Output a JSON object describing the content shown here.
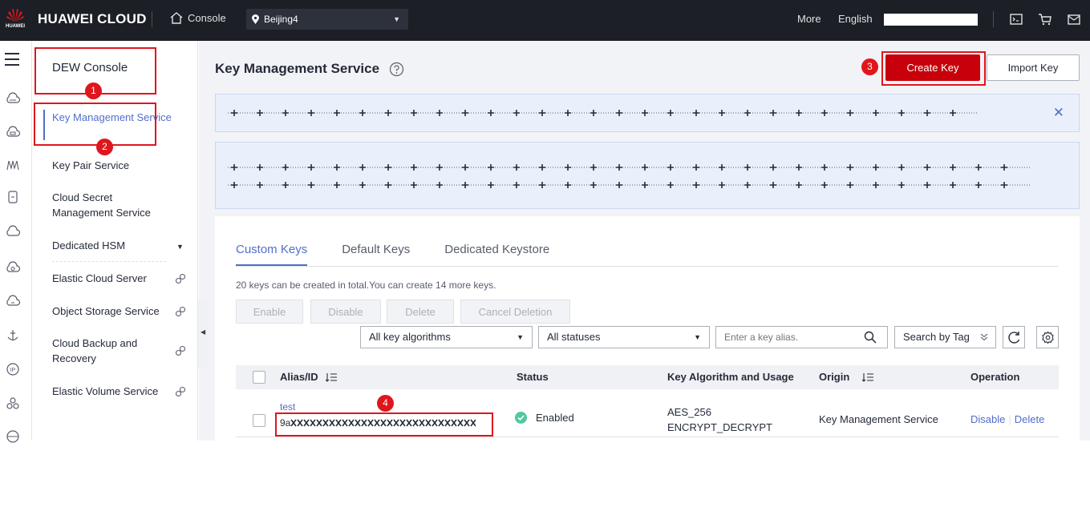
{
  "topbar": {
    "logo_word": "HUAWEI",
    "brand": "HUAWEI CLOUD",
    "console": "Console",
    "region": "Beijing4",
    "more": "More",
    "language": "English"
  },
  "sidebar": {
    "title": "DEW Console",
    "items": [
      {
        "label": "Key Management Service",
        "active": true
      },
      {
        "label": "Key Pair Service"
      },
      {
        "label": "Cloud Secret Management Service"
      },
      {
        "label": "Dedicated HSM"
      },
      {
        "label": "Elastic Cloud Server"
      },
      {
        "label": "Object Storage Service"
      },
      {
        "label": "Cloud Backup and Recovery"
      },
      {
        "label": "Elastic Volume Service"
      }
    ]
  },
  "main": {
    "title": "Key Management Service",
    "create_key": "Create Key",
    "import_key": "Import Key",
    "tabs": [
      "Custom Keys",
      "Default Keys",
      "Dedicated Keystore"
    ],
    "quota": "20 keys can be created in total.You can create 14 more keys.",
    "actions": [
      "Enable",
      "Disable",
      "Delete",
      "Cancel Deletion"
    ],
    "filters": {
      "algorithm": "All key algorithms",
      "status": "All statuses",
      "search_placeholder": "Enter a key alias.",
      "search_by_tag": "Search by Tag"
    },
    "table": {
      "columns": [
        "Alias/ID",
        "Status",
        "Key Algorithm and Usage",
        "Origin",
        "Operation"
      ],
      "rows": [
        {
          "alias": "test",
          "id": "9a",
          "status": "Enabled",
          "algorithm": "AES_256",
          "usage": "ENCRYPT_DECRYPT",
          "origin": "Key Management Service",
          "op_disable": "Disable",
          "op_delete": "Delete"
        }
      ]
    }
  },
  "annotations": [
    "1",
    "2",
    "3",
    "4"
  ],
  "colors": {
    "topbar": "#1c1f26",
    "primary": "#c7000b",
    "link": "#526ecc",
    "annotation": "#e0161d",
    "enabled": "#50c9a0"
  }
}
